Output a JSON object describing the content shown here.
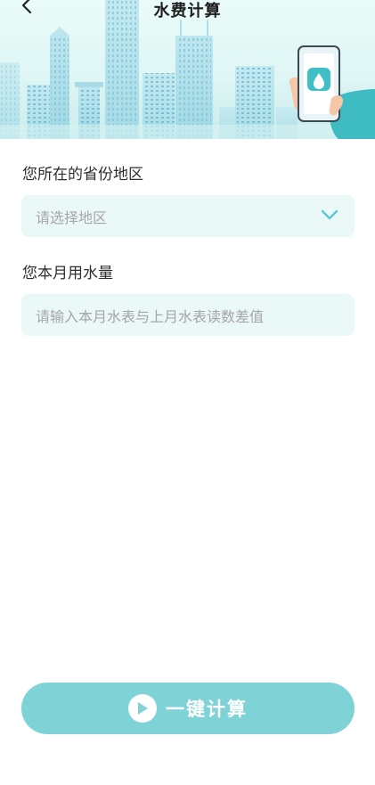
{
  "header": {
    "title": "水费计算",
    "back_icon": "chevron-left-icon"
  },
  "form": {
    "region": {
      "label": "您所在的省份地区",
      "placeholder": "请选择地区",
      "icon": "chevron-down-icon"
    },
    "usage": {
      "label": "您本月用水量",
      "placeholder": "请输入本月水表与上月水表读数差值"
    }
  },
  "action": {
    "label": "一键计算",
    "icon": "play-icon"
  },
  "colors": {
    "accent": "#5fc7cc",
    "button": "#7fd3d6",
    "field_bg": "#eaf9f8",
    "placeholder": "#a6a6a6"
  }
}
